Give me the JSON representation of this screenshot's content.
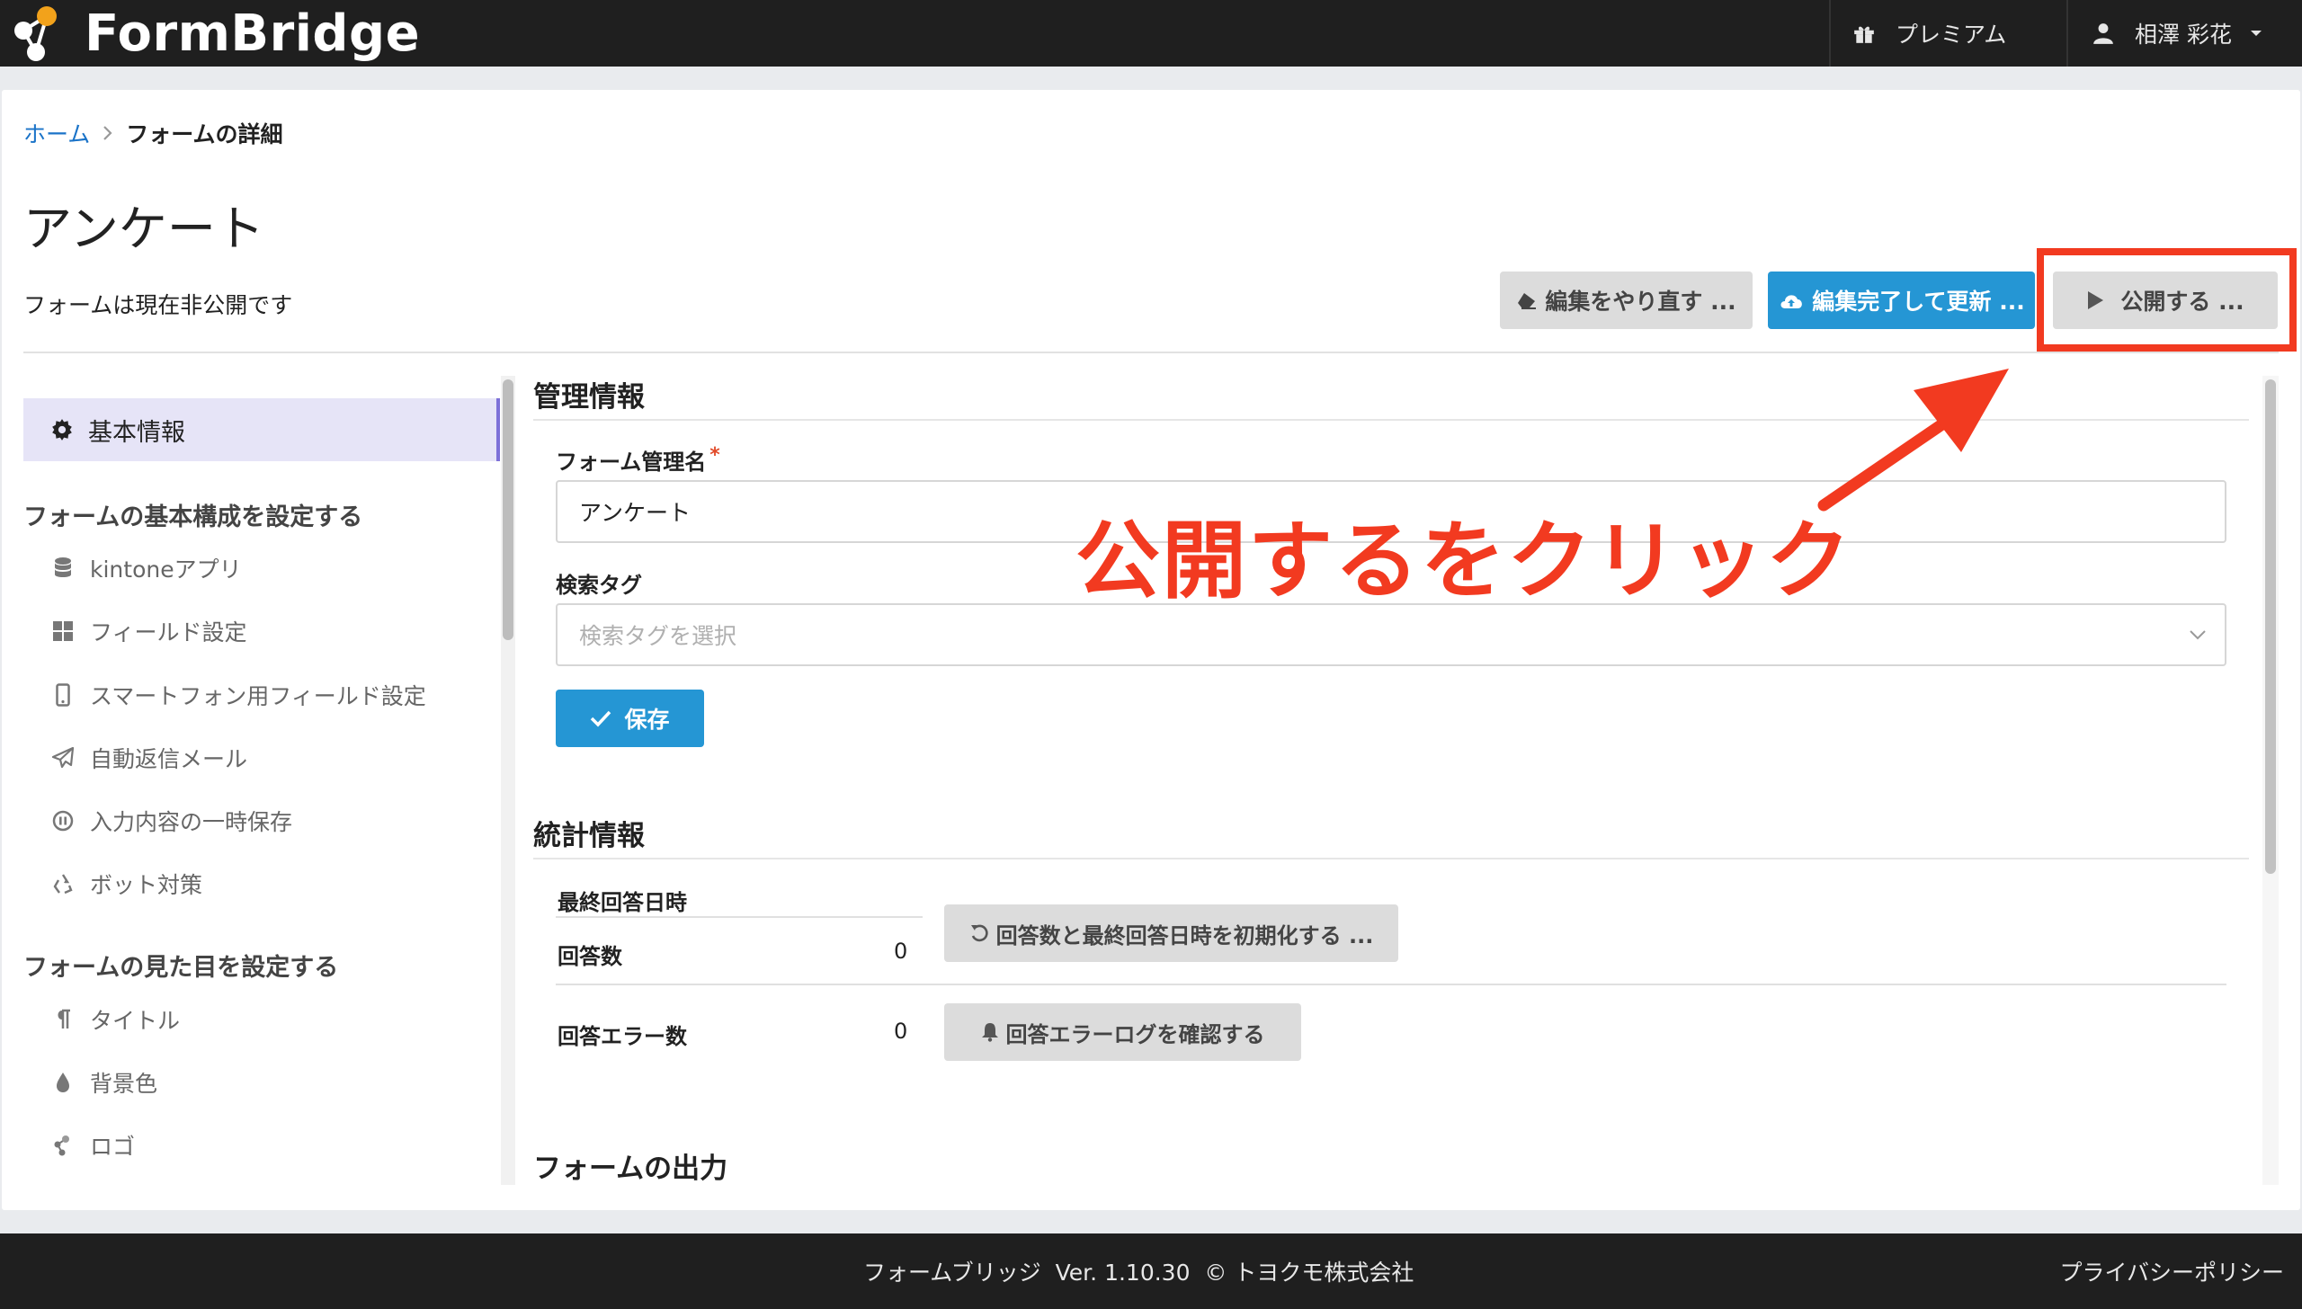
{
  "header": {
    "app_name": "FormBridge",
    "premium_label": "プレミアム",
    "user_name": "相澤 彩花"
  },
  "breadcrumb": {
    "home": "ホーム",
    "current": "フォームの詳細"
  },
  "page": {
    "title": "アンケート",
    "status": "フォームは現在非公開です"
  },
  "toolbar": {
    "redo_label": "編集をやり直す ...",
    "complete_label": "編集完了して更新 ...",
    "publish_label": "公開する ..."
  },
  "sidebar": {
    "active_label": "基本情報",
    "group1_heading": "フォームの基本構成を設定する",
    "group1_items": [
      "kintoneアプリ",
      "フィールド設定",
      "スマートフォン用フィールド設定",
      "自動返信メール",
      "入力内容の一時保存",
      "ボット対策"
    ],
    "group2_heading": "フォームの見た目を設定する",
    "group2_items": [
      "タイトル",
      "背景色",
      "ロゴ"
    ]
  },
  "management": {
    "section_title": "管理情報",
    "name_label": "フォーム管理名",
    "required_mark": "*",
    "name_value": "アンケート",
    "tag_label": "検索タグ",
    "tag_placeholder": "検索タグを選択",
    "save_label": "保存"
  },
  "stats": {
    "section_title": "統計情報",
    "last_answer_label": "最終回答日時",
    "answer_count_label": "回答数",
    "answer_count_value": "0",
    "reset_label": "回答数と最終回答日時を初期化する ...",
    "error_count_label": "回答エラー数",
    "error_count_value": "0",
    "error_log_label": "回答エラーログを確認する"
  },
  "output": {
    "section_title": "フォームの出力"
  },
  "annotation": {
    "text": "公開するをクリック",
    "color": "#f23a20"
  },
  "footer": {
    "version_text": "フォームブリッジ  Ver. 1.10.30  © トヨクモ株式会社",
    "privacy_label": "プライバシーポリシー"
  }
}
